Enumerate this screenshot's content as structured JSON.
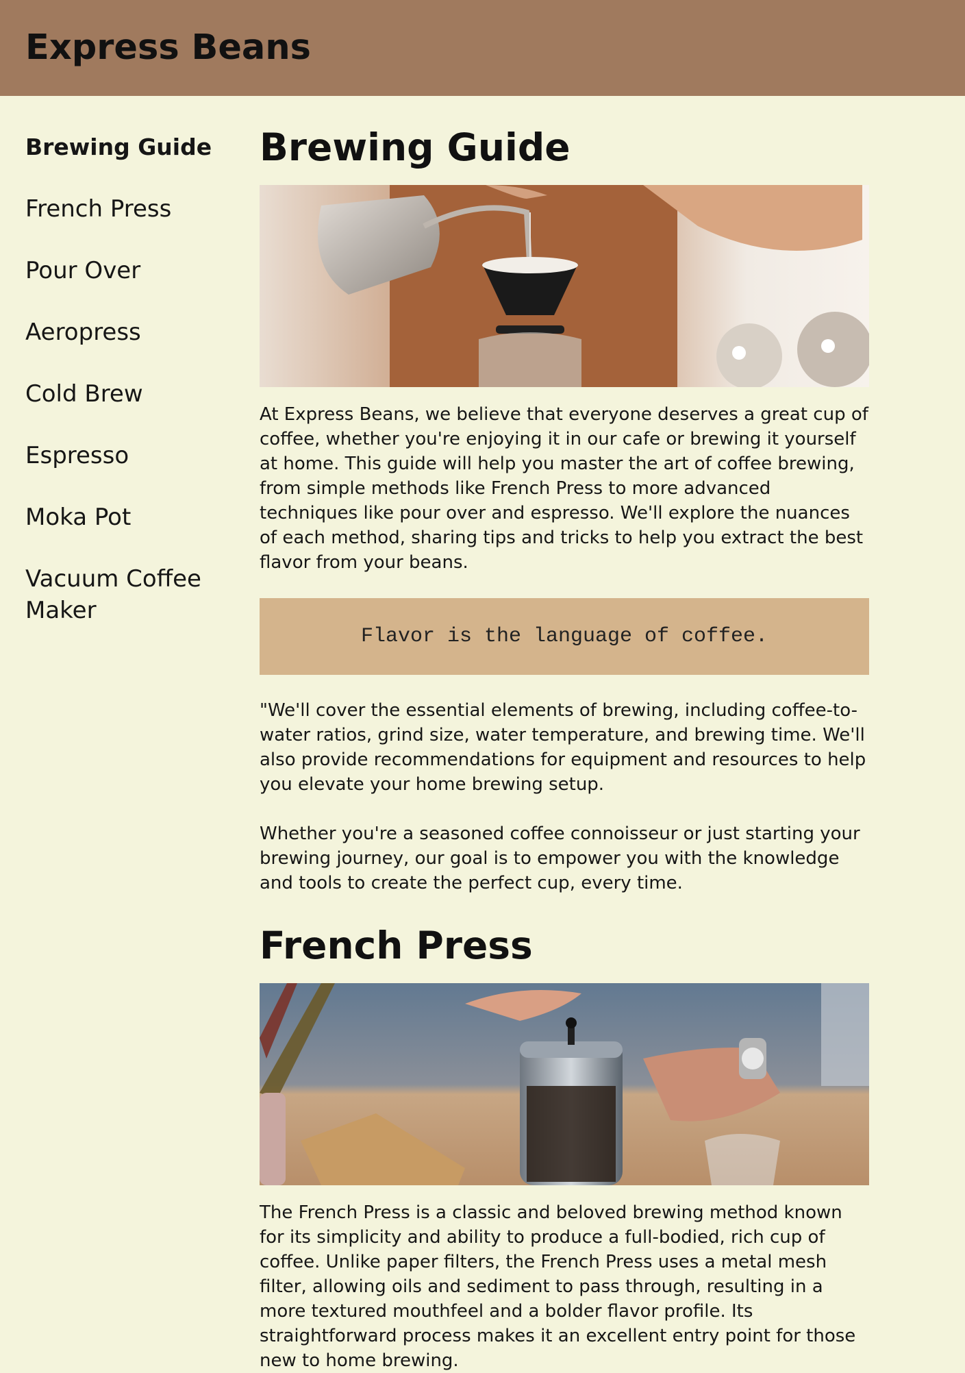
{
  "header": {
    "brand": "Express Beans"
  },
  "sidebar": {
    "items": [
      {
        "label": "Brewing Guide",
        "active": true
      },
      {
        "label": "French Press"
      },
      {
        "label": "Pour Over"
      },
      {
        "label": "Aeropress"
      },
      {
        "label": "Cold Brew"
      },
      {
        "label": "Espresso"
      },
      {
        "label": "Moka Pot"
      },
      {
        "label": "Vacuum Coffee Maker"
      }
    ]
  },
  "main": {
    "section1": {
      "title": "Brewing Guide",
      "intro": "At Express Beans, we believe that everyone deserves a great cup of coffee, whether you're enjoying it in our cafe or brewing it yourself at home. This guide will help you master the art of coffee brewing, from simple methods like French Press to more advanced techniques like pour over and espresso. We'll explore the nuances of each method, sharing tips and tricks to help you extract the best flavor from your beans.",
      "quote": "Flavor is the language of coffee.",
      "para2": "\"We'll cover the essential elements of brewing, including coffee-to-water ratios, grind size, water temperature, and brewing time. We'll also provide recommendations for equipment and resources to help you elevate your home brewing setup.",
      "para3": "Whether you're a seasoned coffee connoisseur or just starting your brewing journey, our goal is to empower you with the knowledge and tools to create the perfect cup, every time."
    },
    "section2": {
      "title": "French Press",
      "body": "The French Press is a classic and beloved brewing method known for its simplicity and ability to produce a full-bodied, rich cup of coffee. Unlike paper filters, the French Press uses a metal mesh filter, allowing oils and sediment to pass through, resulting in a more textured mouthfeel and a bolder flavor profile. Its straightforward process makes it an excellent entry point for those new to home brewing."
    }
  },
  "colors": {
    "header_bg": "#a07a5e",
    "page_bg": "#f4f4dc",
    "quote_bg": "#d4b48c"
  }
}
